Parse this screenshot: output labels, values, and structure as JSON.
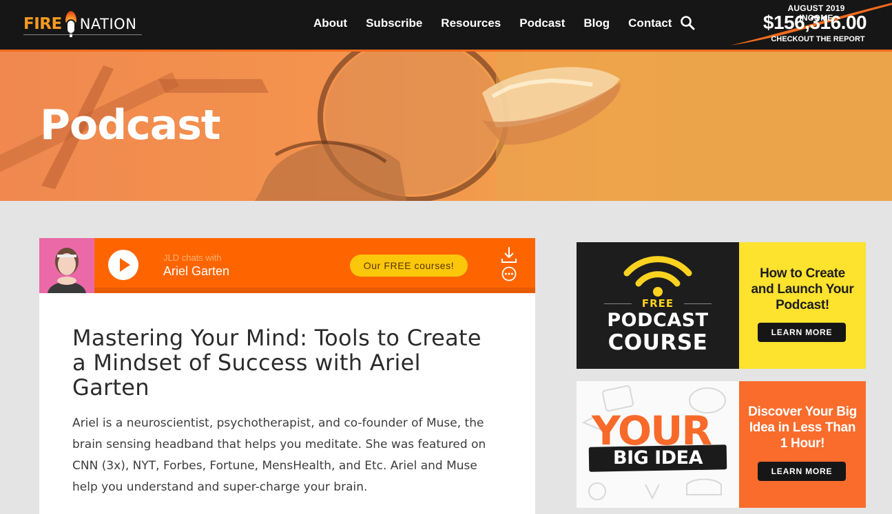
{
  "brand": {
    "logo_part1": "FIRE",
    "logo_part2": "NATION"
  },
  "nav": {
    "items": [
      {
        "label": "About"
      },
      {
        "label": "Subscribe"
      },
      {
        "label": "Resources"
      },
      {
        "label": "Podcast"
      },
      {
        "label": "Blog"
      },
      {
        "label": "Contact"
      }
    ],
    "search_icon": "search-icon"
  },
  "income_badge": {
    "line1": "AUGUST 2019 INCOME",
    "amount": "$156,316.00",
    "line3": "CHECKOUT THE REPORT"
  },
  "hero": {
    "title": "Podcast"
  },
  "player": {
    "subtitle": "JLD chats with",
    "guest": "Ariel Garten",
    "cta": "Our FREE courses!",
    "icons": [
      "play-icon",
      "download-icon",
      "more-options-icon"
    ]
  },
  "article": {
    "title": "Mastering Your Mind: Tools to Create a Mindset of Success with Ariel Garten",
    "body": "Ariel is a neuroscientist, psychotherapist, and co-founder of Muse, the brain sensing headband that helps you meditate. She was featured on CNN (3x), NYT, Forbes, Fortune, MensHealth, and Etc. Ariel and Muse help you understand and super-charge your brain."
  },
  "ads": [
    {
      "free_label": "FREE",
      "line1": "PODCAST",
      "line2": "COURSE",
      "headline": "How to Create and Launch Your Podcast!",
      "button": "LEARN MORE"
    },
    {
      "line1": "YOUR",
      "line2": "BIG IDEA",
      "headline": "Discover Your Big Idea in Less Than 1 Hour!",
      "button": "LEARN MORE"
    }
  ],
  "colors": {
    "accent": "#fe6501",
    "nav_bg": "#161616",
    "cta_yellow": "#fbc70a"
  }
}
